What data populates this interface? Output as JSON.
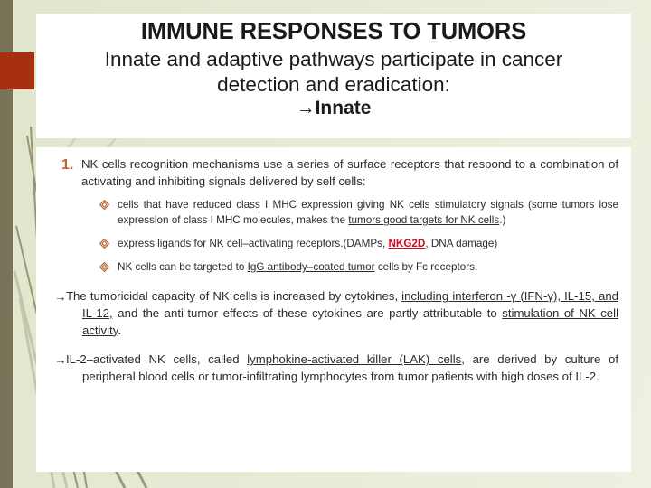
{
  "theme": {
    "background": "#e4ead2",
    "olive_bar": "#797458",
    "red_block": "#a92f11",
    "card_background": "#ffffff",
    "number_marker_color": "#c3622c",
    "diamond_bullet_color": "#b5652e",
    "highlight_red": "#d2091b",
    "body_text_color": "#2b2b2b"
  },
  "title": {
    "main": "IMMUNE RESPONSES TO TUMORS",
    "subtitle_line1": "Innate and adaptive pathways participate in cancer",
    "subtitle_line2": "detection and eradication:",
    "arrow_line": "→Innate"
  },
  "content": {
    "numbered": [
      {
        "marker": "1.",
        "text": "NK cells recognition mechanisms use a series of surface receptors that respond to a combination of activating and inhibiting signals delivered by self cells:"
      }
    ],
    "sub_bullets": [
      {
        "bullet_icon": "diamond-bullet-icon",
        "text_part1": "cells that have reduced class I MHC expression giving NK cells stimulatory signals (some tumors lose expression of class I MHC molecules, makes the ",
        "underlined": "tumors good targets for NK cells",
        "text_part2": ".)"
      },
      {
        "bullet_icon": "diamond-bullet-icon",
        "text_part1": "express ligands for NK cell–activating receptors.(DAMPs, ",
        "highlighted": "NKG2D",
        "text_part2": ", DNA damage)"
      },
      {
        "bullet_icon": "diamond-bullet-icon",
        "text_part1": "NK cells can be targeted to ",
        "underlined": "IgG antibody–coated tumor",
        "text_part2": " cells by Fc receptors."
      }
    ],
    "arrow_paragraphs": [
      {
        "marker": "→",
        "part1": "The tumoricidal capacity of NK cells is increased by cytokines, ",
        "underlined1": "including interferon -γ (IFN-γ), IL-15, and IL-12,",
        "part2": " and the anti-tumor effects of these cytokines are partly attributable to ",
        "underlined2": "stimulation of NK cell activity",
        "part3": "."
      },
      {
        "marker": "→",
        "part1": "IL-2–activated NK cells, called ",
        "underlined1": "lymphokine-activated killer (LAK) cells",
        "part2": ", are derived by culture of peripheral blood cells or tumor-infiltrating lymphocytes from tumor patients with high doses of IL-2.",
        "underlined2": "",
        "part3": ""
      }
    ]
  }
}
